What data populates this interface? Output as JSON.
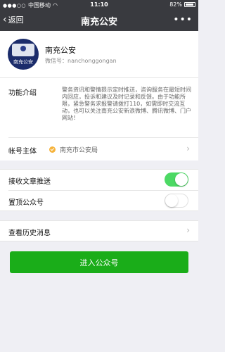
{
  "status_bar": {
    "carrier": "中国移动",
    "time": "11:10",
    "battery": "82%",
    "battery_level": 0.82
  },
  "nav": {
    "back_label": "返回",
    "title": "南充公安",
    "more_label": "•••"
  },
  "profile": {
    "name": "南充公安",
    "wechat_id_label": "微信号：",
    "wechat_id": "nanchonggongan",
    "avatar_caption": "南充公安"
  },
  "info": {
    "intro_label": "功能介绍",
    "intro_text": "警务资讯和警情提示定时推送，咨询服务在最短时间内回应，投诉和建议及时记录和反馈。由于功能所限，紧急警务求报警请拨打110，如需即时交流互动，也可以关注南充公安新浪微博、腾讯微博、门户网站！",
    "owner_label": "帐号主体",
    "owner_value": "南充市公安局"
  },
  "settings": {
    "receive_push_label": "接收文章推送",
    "receive_push_on": true,
    "pin_label": "置顶公众号",
    "pin_on": false
  },
  "history": {
    "label": "查看历史消息"
  },
  "enter_button": {
    "label": "进入公众号"
  }
}
